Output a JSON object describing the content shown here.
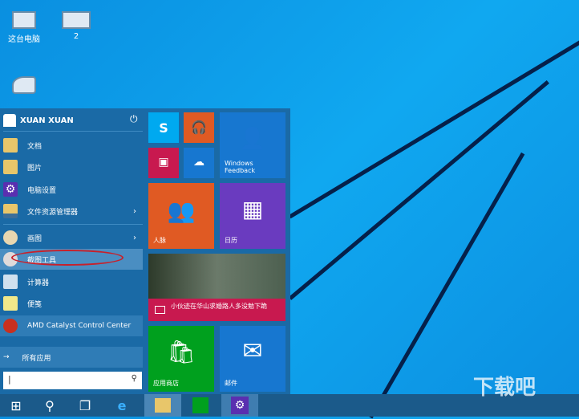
{
  "desktop": {
    "icons": [
      {
        "label": "这台电脑"
      },
      {
        "label": "2"
      },
      {
        "label": ""
      }
    ]
  },
  "start": {
    "user": "XUAN XUAN",
    "items": [
      {
        "label": "文档",
        "icon": "documents-folder-icon"
      },
      {
        "label": "图片",
        "icon": "pictures-folder-icon"
      },
      {
        "label": "电脑设置",
        "icon": "settings-gear-icon"
      },
      {
        "label": "文件资源管理器",
        "icon": "file-explorer-icon"
      },
      {
        "label": "画图",
        "icon": "paint-icon"
      },
      {
        "label": "截图工具",
        "icon": "snipping-tool-icon"
      },
      {
        "label": "计算器",
        "icon": "calculator-icon"
      },
      {
        "label": "便笺",
        "icon": "sticky-notes-icon"
      },
      {
        "label": "AMD Catalyst Control Center",
        "icon": "amd-catalyst-icon"
      }
    ],
    "all_apps": "所有应用",
    "search_value": "|",
    "tiles": {
      "feedback": "Windows Feedback",
      "people": "人脉",
      "calendar": "日历",
      "news": "小伙迹在华山求婚路人多没勉下跪",
      "store": "应用商店",
      "mail": "邮件"
    }
  },
  "watermark": "下载吧",
  "colors": {
    "accent": "#1a6aa6",
    "store": "#00a01e",
    "people": "#e05a23",
    "calendar": "#6a3bbf",
    "news": "#c8194f",
    "mail": "#1777d0"
  }
}
